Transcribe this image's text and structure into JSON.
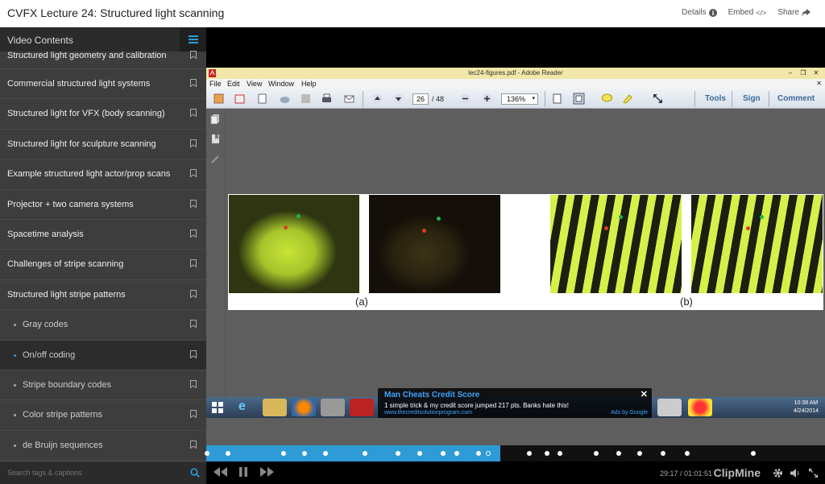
{
  "header": {
    "title": "CVFX Lecture 24: Structured light scanning",
    "details_label": "Details",
    "embed_label": "Embed",
    "share_label": "Share"
  },
  "sidebar": {
    "heading": "Video Contents",
    "items": [
      {
        "label": "Structured light geometry and calibration"
      },
      {
        "label": "Commercial structured light systems"
      },
      {
        "label": "Structured light for VFX (body scanning)"
      },
      {
        "label": "Structured light for sculpture scanning"
      },
      {
        "label": "Example structured light actor/prop scans"
      },
      {
        "label": "Projector + two camera systems"
      },
      {
        "label": "Spacetime analysis"
      },
      {
        "label": "Challenges of stripe scanning"
      },
      {
        "label": "Structured light stripe patterns"
      },
      {
        "label": "Gray codes"
      },
      {
        "label": "On/off coding"
      },
      {
        "label": "Stripe boundary codes"
      },
      {
        "label": "Color stripe patterns"
      },
      {
        "label": "de Bruijn sequences"
      }
    ],
    "search_placeholder": "Search tags & captions"
  },
  "reader": {
    "title": "lec24-figures.pdf - Adobe Reader",
    "menu": [
      "File",
      "Edit",
      "View",
      "Window",
      "Help"
    ],
    "page_current": "26",
    "page_total": "/ 48",
    "zoom": "136%",
    "tools_label": "Tools",
    "sign_label": "Sign",
    "comment_label": "Comment",
    "caption_a": "(a)",
    "caption_b": "(b)"
  },
  "taskbar": {
    "time": "10:38 AM",
    "date": "4/24/2014"
  },
  "ad": {
    "title": "Man Cheats Credit Score",
    "text": "1 simple trick & my credit score jumped 217 pts. Banks hate this!",
    "url": "www.thecreditsolutionprogram.com",
    "by": "Ads by Google"
  },
  "player": {
    "progress": 0.475,
    "time": "29:17 / 01:01:51",
    "brand": "ClipMine"
  },
  "colors": {
    "accent": "#2e9bd6",
    "sidebar_bg": "#3d3d3d"
  }
}
